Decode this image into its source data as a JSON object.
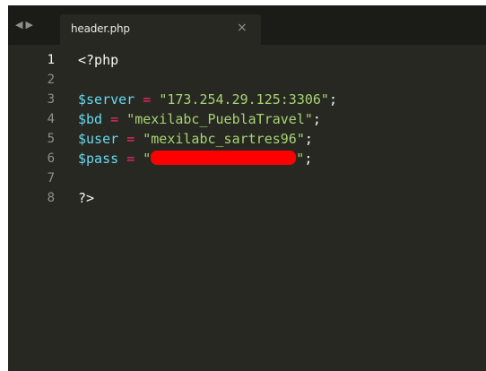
{
  "tab": {
    "filename": "header.php",
    "close_glyph": "×"
  },
  "nav": {
    "back_glyph": "◀",
    "forward_glyph": "▶"
  },
  "lines": [
    {
      "number": "1",
      "open": "<?php"
    },
    {
      "number": "2"
    },
    {
      "number": "3",
      "var": "$server",
      "op": "=",
      "value": "\"173.254.29.125:3306\"",
      "end": ";"
    },
    {
      "number": "4",
      "var": "$bd",
      "op": "=",
      "value": "\"mexilabc_PueblaTravel\"",
      "end": ";"
    },
    {
      "number": "5",
      "var": "$user",
      "op": "=",
      "value": "\"mexilabc_sartres96\"",
      "end": ";"
    },
    {
      "number": "6",
      "var": "$pass",
      "op": "=",
      "quote_open": "\"",
      "quote_close": "\"",
      "end": ";"
    },
    {
      "number": "7"
    },
    {
      "number": "8",
      "close": "?>"
    }
  ],
  "colors": {
    "background": "#272822",
    "tabbar": "#1b1c17",
    "variable": "#66d9ef",
    "operator": "#f92672",
    "string": "#a6e22e",
    "redaction": "#ff0000"
  }
}
